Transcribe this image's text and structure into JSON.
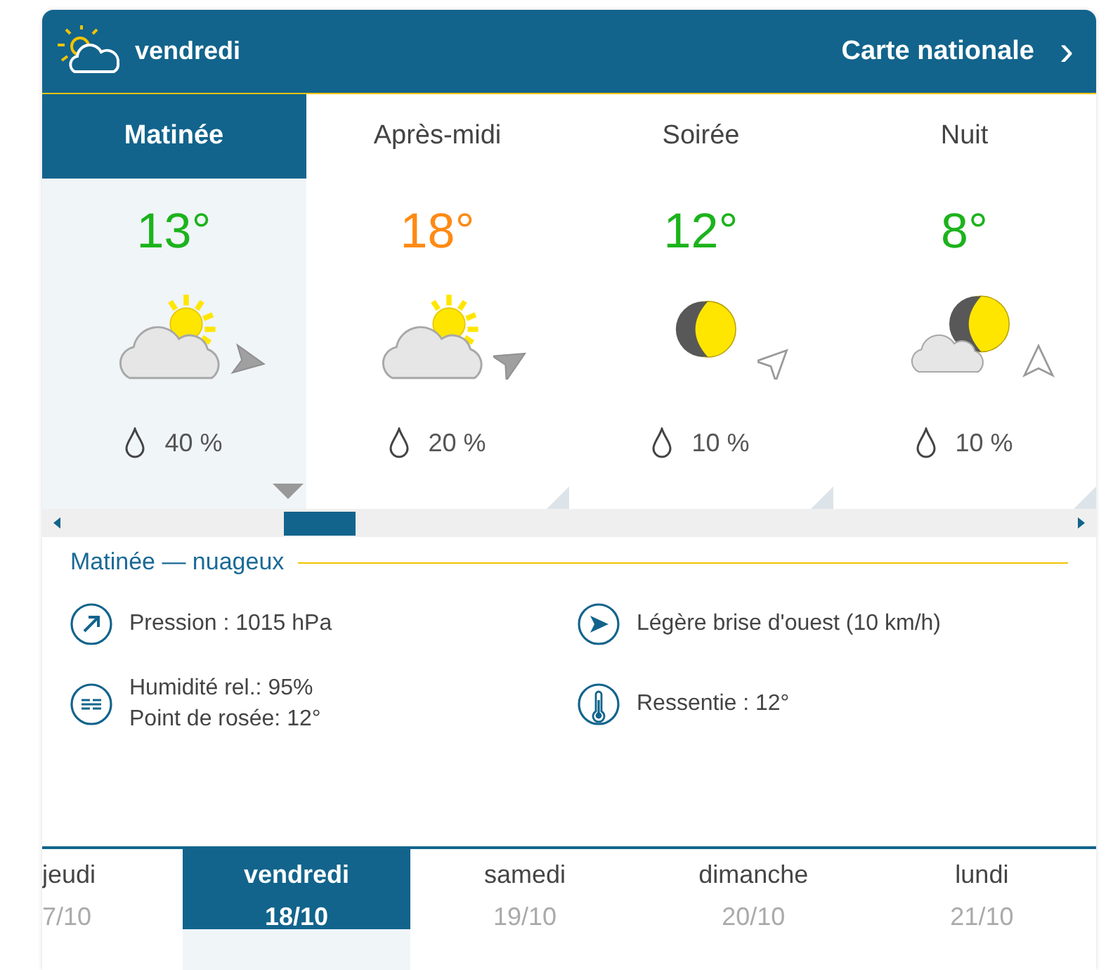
{
  "header": {
    "day": "vendredi",
    "link": "Carte nationale",
    "chevron": "›"
  },
  "periods": [
    {
      "label": "Matinée",
      "selected": true,
      "temperature": "13°",
      "color": "#1cb31c",
      "kind": "cloud-sun",
      "precipitation": "40 %"
    },
    {
      "label": "Après-midi",
      "selected": false,
      "temperature": "18°",
      "color": "#ff8a14",
      "kind": "cloud-sun",
      "precipitation": "20 %"
    },
    {
      "label": "Soirée",
      "selected": false,
      "temperature": "12°",
      "color": "#1cb31c",
      "kind": "moon",
      "precipitation": "10 %"
    },
    {
      "label": "Nuit",
      "selected": false,
      "temperature": "8°",
      "color": "#1cb31c",
      "kind": "cloud-moon",
      "precipitation": "10 %"
    }
  ],
  "details": {
    "title": "Matinée — nuageux",
    "items": [
      {
        "kind": "pressure",
        "lines": [
          "Pression : 1015 hPa"
        ]
      },
      {
        "kind": "wind",
        "lines": [
          "Légère brise d'ouest (10 km/h)"
        ]
      },
      {
        "kind": "humidity",
        "lines": [
          "Humidité rel.: 95%",
          "Point de rosée: 12°"
        ]
      },
      {
        "kind": "feels",
        "lines": [
          "Ressentie : 12°"
        ]
      }
    ]
  },
  "days": [
    {
      "name": "jeudi",
      "date": "7/10",
      "selected": false
    },
    {
      "name": "vendredi",
      "date": "18/10",
      "selected": true
    },
    {
      "name": "samedi",
      "date": "19/10",
      "selected": false
    },
    {
      "name": "dimanche",
      "date": "20/10",
      "selected": false
    },
    {
      "name": "lundi",
      "date": "21/10",
      "selected": false
    }
  ]
}
